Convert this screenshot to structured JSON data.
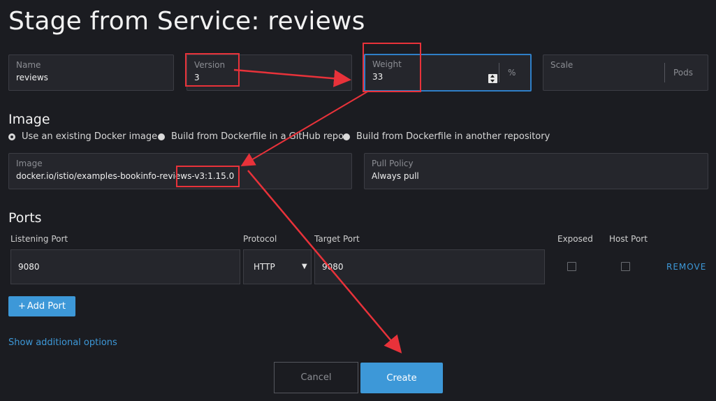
{
  "page": {
    "title": "Stage from Service: reviews"
  },
  "fields": {
    "name": {
      "label": "Name",
      "value": "reviews"
    },
    "version": {
      "label": "Version",
      "value": "3"
    },
    "weight": {
      "label": "Weight",
      "value": "33",
      "suffix": "%"
    },
    "scale": {
      "label": "Scale",
      "value": "",
      "suffix": "Pods"
    }
  },
  "image_section": {
    "title": "Image",
    "options": [
      {
        "label": "Use an existing Docker image",
        "selected": true
      },
      {
        "label": "Build from Dockerfile in a GitHub repo",
        "selected": false
      },
      {
        "label": "Build from Dockerfile in another repository",
        "selected": false
      }
    ],
    "image": {
      "label": "Image",
      "value": "docker.io/istio/examples-bookinfo-reviews-v3:1.15.0"
    },
    "pull_policy": {
      "label": "Pull Policy",
      "value": "Always pull"
    }
  },
  "ports": {
    "title": "Ports",
    "columns": {
      "listening": "Listening Port",
      "protocol": "Protocol",
      "target": "Target Port",
      "exposed": "Exposed",
      "host": "Host Port"
    },
    "rows": [
      {
        "listening": "9080",
        "protocol": "HTTP",
        "target": "9080",
        "exposed": false,
        "host_port": false,
        "remove_label": "REMOVE"
      }
    ],
    "add_label": "Add Port",
    "add_icon": "plus-icon"
  },
  "links": {
    "additional_options": "Show additional options"
  },
  "actions": {
    "cancel": "Cancel",
    "create": "Create"
  },
  "colors": {
    "accent": "#3d98d8",
    "focus_border": "#2f7fc8",
    "annotation": "#e8323a",
    "background": "#1b1c21",
    "field_bg": "#25262c"
  }
}
